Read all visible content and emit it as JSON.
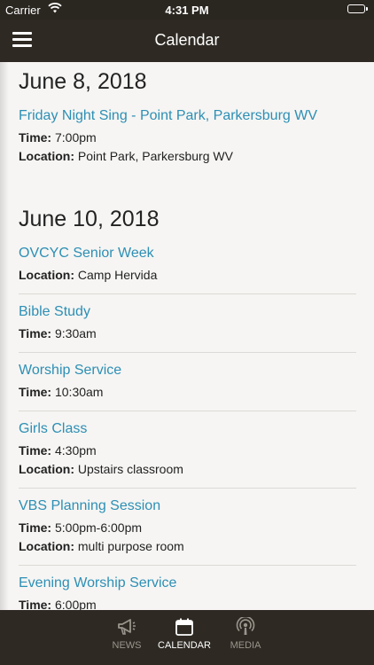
{
  "status_bar": {
    "carrier": "Carrier",
    "time": "4:31 PM"
  },
  "nav": {
    "title": "Calendar"
  },
  "days": [
    {
      "date": "June 8, 2018",
      "events": [
        {
          "title": "Friday Night Sing - Point Park, Parkersburg WV",
          "details": [
            {
              "label": "Time:",
              "value": " 7:00pm"
            },
            {
              "label": "Location:",
              "value": " Point Park, Parkersburg WV"
            }
          ]
        }
      ]
    },
    {
      "date": "June 10, 2018",
      "events": [
        {
          "title": "OVCYC Senior Week",
          "details": [
            {
              "label": "Location:",
              "value": " Camp Hervida"
            }
          ]
        },
        {
          "title": "Bible Study",
          "details": [
            {
              "label": "Time:",
              "value": " 9:30am"
            }
          ]
        },
        {
          "title": "Worship Service",
          "details": [
            {
              "label": "Time:",
              "value": " 10:30am"
            }
          ]
        },
        {
          "title": "Girls Class",
          "details": [
            {
              "label": "Time:",
              "value": " 4:30pm"
            },
            {
              "label": "Location:",
              "value": " Upstairs classroom"
            }
          ]
        },
        {
          "title": "VBS Planning Session",
          "details": [
            {
              "label": "Time:",
              "value": " 5:00pm-6:00pm"
            },
            {
              "label": "Location:",
              "value": " multi purpose room"
            }
          ]
        },
        {
          "title": "Evening Worship Service",
          "details": [
            {
              "label": "Time:",
              "value": " 6:00pm"
            }
          ]
        }
      ]
    }
  ],
  "tabs": [
    {
      "label": "NEWS",
      "icon": "megaphone-icon",
      "active": false
    },
    {
      "label": "CALENDAR",
      "icon": "calendar-icon",
      "active": true
    },
    {
      "label": "MEDIA",
      "icon": "podcast-icon",
      "active": false
    }
  ],
  "colors": {
    "bar": "#2e2a23",
    "link": "#2d8fb5",
    "background": "#f6f5f3"
  }
}
